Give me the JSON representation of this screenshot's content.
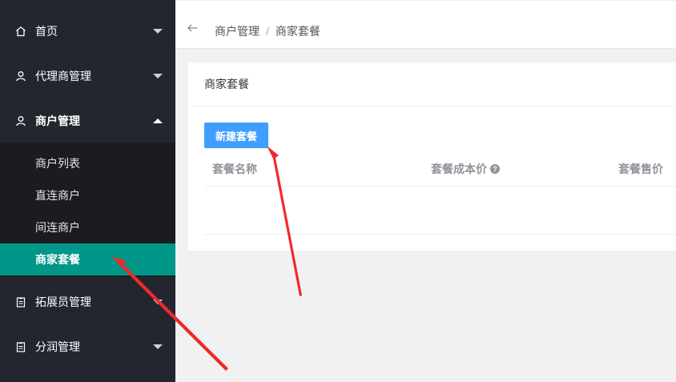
{
  "sidebar": {
    "items": [
      {
        "label": "首页",
        "icon": "home-icon"
      },
      {
        "label": "代理商管理",
        "icon": "user-icon"
      },
      {
        "label": "商户管理",
        "icon": "user-icon"
      },
      {
        "label": "拓展员管理",
        "icon": "clipboard-icon"
      },
      {
        "label": "分润管理",
        "icon": "clipboard-icon"
      }
    ],
    "submenu": [
      {
        "label": "商户列表"
      },
      {
        "label": "直连商户"
      },
      {
        "label": "间连商户"
      },
      {
        "label": "商家套餐"
      }
    ]
  },
  "header": {
    "breadcrumb": [
      "商户管理",
      "/",
      "商家套餐"
    ]
  },
  "main": {
    "card_title": "商家套餐",
    "new_button": "新建套餐",
    "columns": [
      "套餐名称",
      "套餐成本价",
      "套餐售价"
    ],
    "help_glyph": "?"
  },
  "colors": {
    "sidebar_bg": "#23262e",
    "active_bg": "#009688",
    "primary_button": "#409eff",
    "annotation_arrow": "#f0282a"
  }
}
